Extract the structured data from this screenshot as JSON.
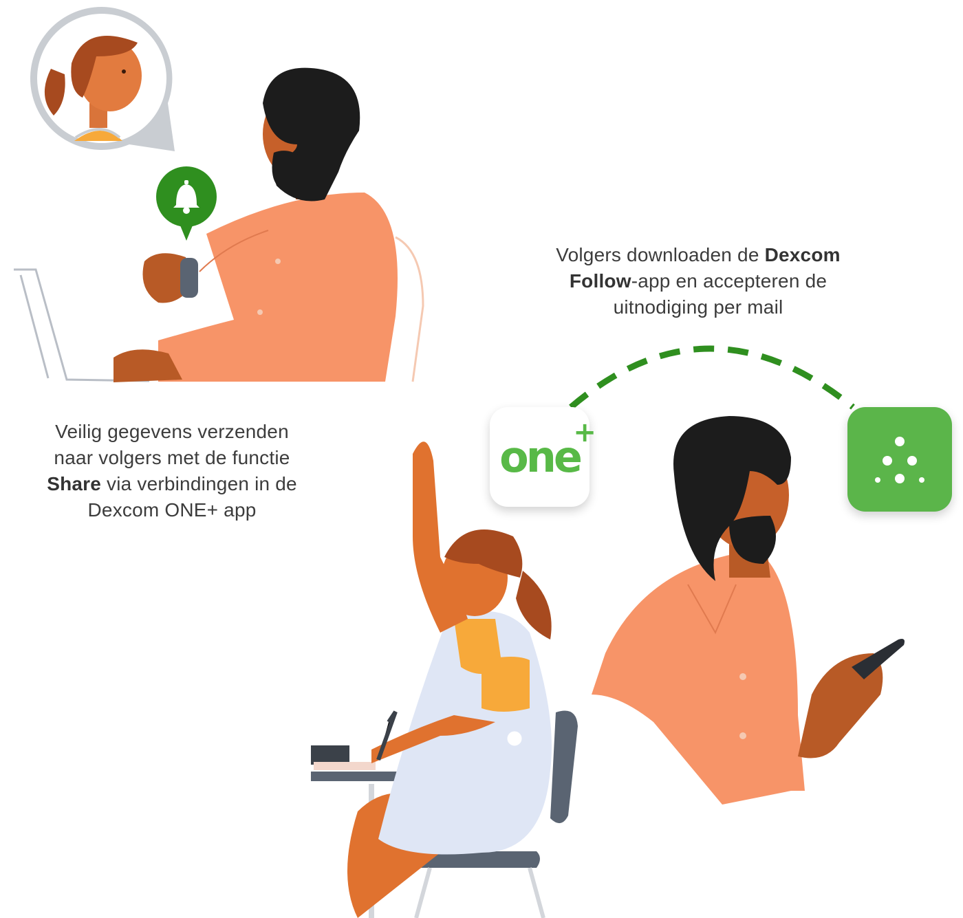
{
  "left_caption": {
    "line1": "Veilig gegevens verzenden",
    "line2": "naar volgers met de functie",
    "bold": "Share",
    "line3_rest": " via verbindingen in de",
    "line4": "Dexcom ONE+ app"
  },
  "right_caption": {
    "line1_pre": "Volgers downloaden de ",
    "bold1": "Dexcom",
    "bold2": "Follow",
    "line2_rest": "-app en accepteren de",
    "line3": "uitnodiging per mail"
  },
  "apps": {
    "one_plus_label": "one",
    "one_plus_plus": "+"
  },
  "icons": {
    "notification": "bell-icon",
    "follow_app": "dexcom-follow-icon"
  },
  "colors": {
    "brand_green": "#5bb54a",
    "bell_green": "#2f8f1f",
    "shirt": "#f79468",
    "skin": "#c6602a"
  }
}
